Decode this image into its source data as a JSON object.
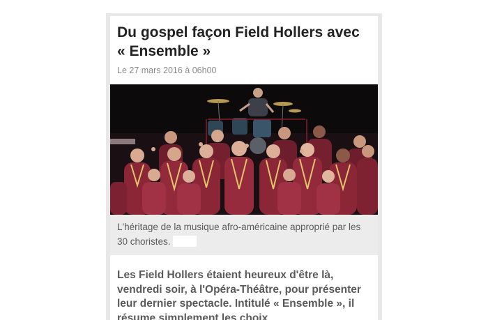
{
  "article": {
    "title": "Du gospel façon Field Hollers avec « Ensemble »",
    "date": "Le 27 mars 2016 à 06h00",
    "photo": {
      "icon": "gospel-choir-photo"
    },
    "caption": "L'héritage de la musique afro-américaine approprié par les 30 choristes.",
    "lede": "Les Field Hollers étaient heureux d'être là, vendredi soir, à l'Opéra-Théâtre, pour présenter leur dernier spectacle. Intitulé « Ensemble », il résume simplement les choix"
  }
}
